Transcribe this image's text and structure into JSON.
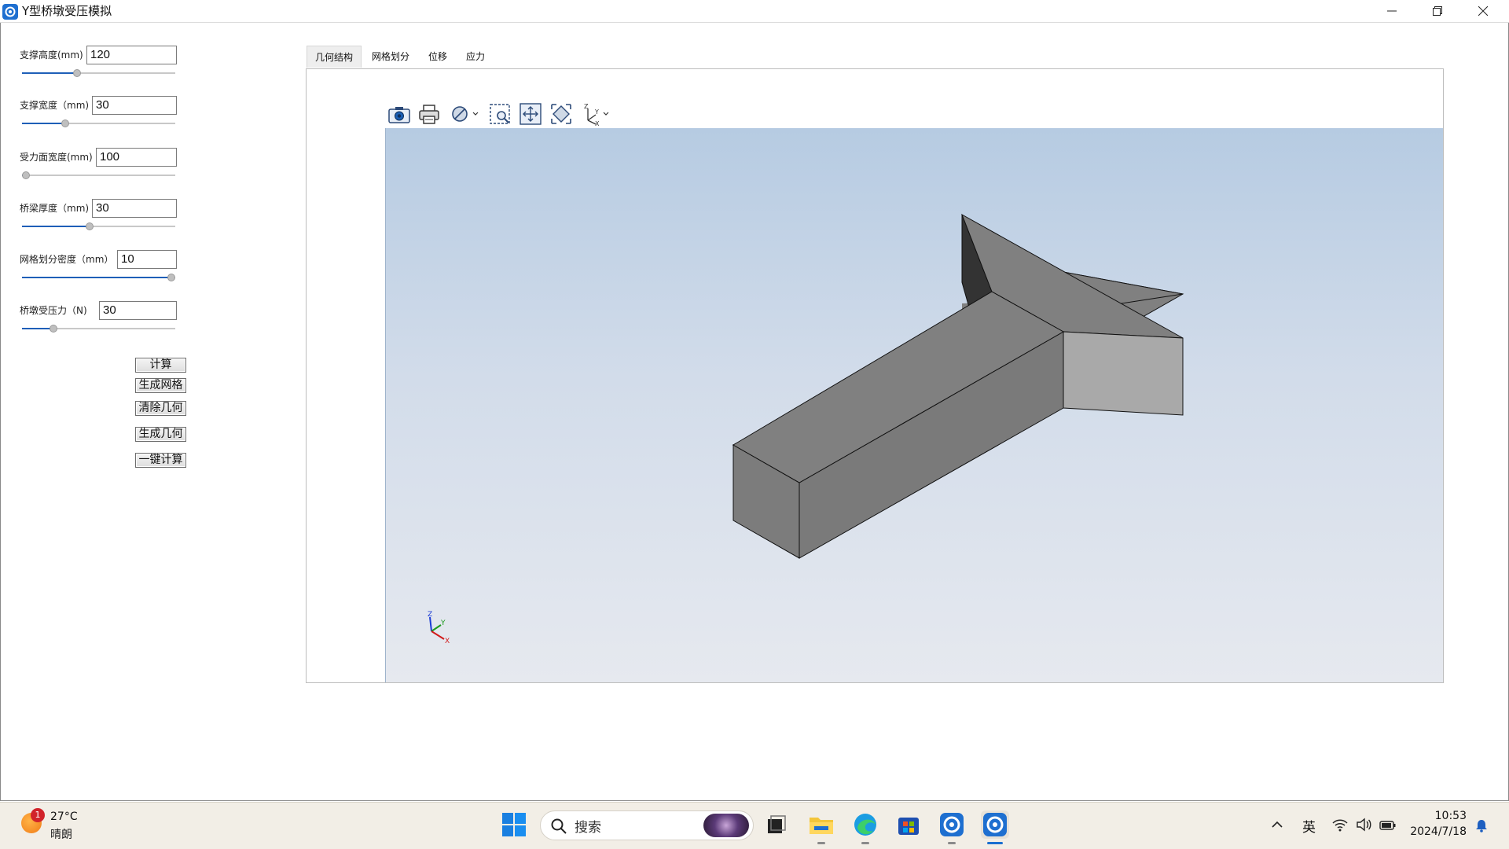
{
  "window": {
    "title": "Y型桥墩受压模拟"
  },
  "params": [
    {
      "label": "支撑高度(mm)",
      "value": "120",
      "slider": 0.35
    },
    {
      "label": "支撑宽度（mm)",
      "value": "30",
      "slider": 0.27
    },
    {
      "label": "受力面宽度(mm)",
      "value": "100",
      "slider": 0.0
    },
    {
      "label": "桥梁厚度（mm)",
      "value": "30",
      "slider": 0.44
    },
    {
      "label": "网格划分密度（mm）",
      "value": "10",
      "slider": 1.0
    },
    {
      "label": "桥墩受压力（N)",
      "value": "30",
      "slider": 0.19
    }
  ],
  "buttons": {
    "calculate": "计算",
    "generate_mesh": "生成网格",
    "clear_geometry": "清除几何",
    "generate_geometry": "生成几何",
    "one_click_calculate": "一键计算"
  },
  "tabs": [
    {
      "label": "几何结构",
      "active": true
    },
    {
      "label": "网格划分",
      "active": false
    },
    {
      "label": "位移",
      "active": false
    },
    {
      "label": "应力",
      "active": false
    }
  ],
  "toolbar": [
    "camera-icon",
    "print-icon",
    "display-mode-icon",
    "zoom-box-icon",
    "pan-icon",
    "fit-view-icon",
    "axis-view-icon"
  ],
  "viewport": {
    "background_top": "#b6cbe2",
    "background_bottom": "#e6e9ef",
    "model_color": "#808080",
    "triad": {
      "z": "Z",
      "y": "Y",
      "x": "X"
    }
  },
  "taskbar": {
    "weather": {
      "badge": "1",
      "temp": "27°C",
      "condition": "晴朗"
    },
    "search_placeholder": "搜索",
    "language": "英",
    "time": "10:53",
    "date": "2024/7/18"
  }
}
